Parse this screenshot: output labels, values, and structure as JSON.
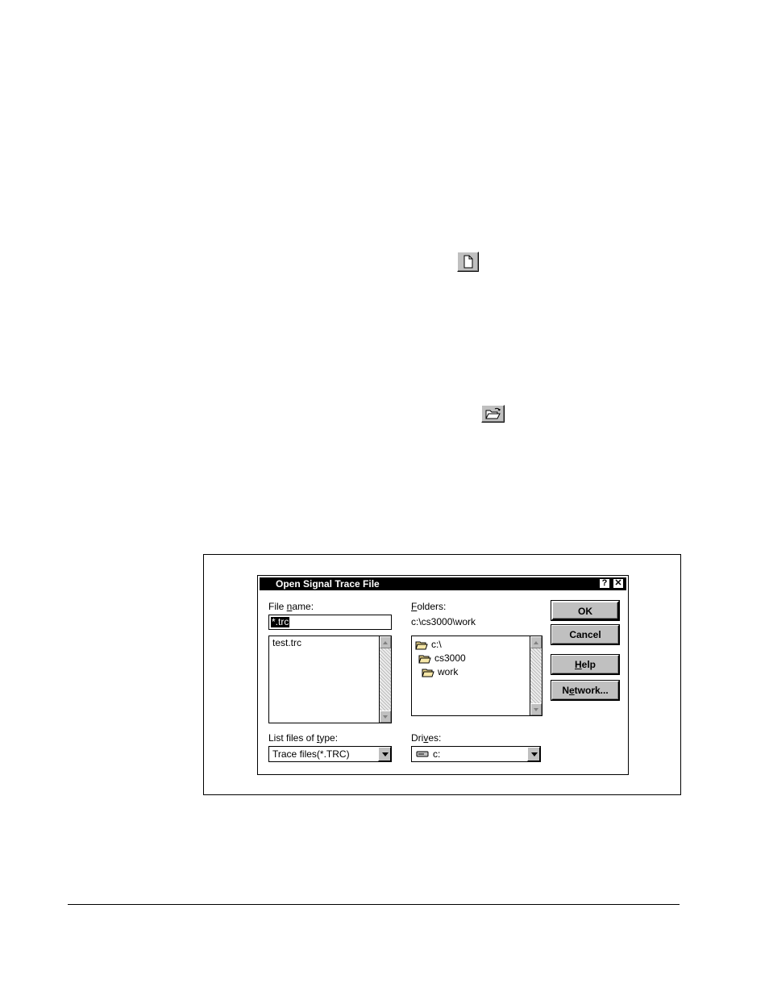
{
  "page": {
    "icons": [
      "new-file-icon",
      "open-folder-icon"
    ]
  },
  "dialog": {
    "title": "Open Signal Trace File",
    "help_btn": "?",
    "close_btn": "✕",
    "file_name": {
      "label_pre": "File ",
      "label_ul": "n",
      "label_post": "ame:",
      "value": "*.trc"
    },
    "file_list": [
      "test.trc"
    ],
    "folders": {
      "label_ul": "F",
      "label_post": "olders:",
      "path": "c:\\cs3000\\work",
      "tree": [
        "c:\\",
        "cs3000",
        "work"
      ]
    },
    "file_type": {
      "label_pre": "List files of ",
      "label_ul": "t",
      "label_post": "ype:",
      "value": "Trace files(*.TRC)"
    },
    "drives": {
      "label_pre": "Dri",
      "label_ul": "v",
      "label_post": "es:",
      "value": "c:"
    },
    "buttons": {
      "ok": "OK",
      "cancel": "Cancel",
      "help_ul": "H",
      "help_post": "elp",
      "network_pre": "N",
      "network_ul": "e",
      "network_post": "twork..."
    }
  }
}
